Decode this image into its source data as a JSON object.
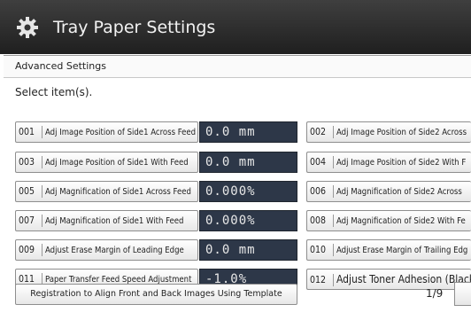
{
  "window": {
    "title": "Tray Paper Settings",
    "icon": "gear-icon"
  },
  "breadcrumb": "Advanced Settings",
  "prompt": "Select item(s).",
  "left_items": [
    {
      "num": "001",
      "label": "Adj Image Position of Side1 Across Feed",
      "value": "0.0 mm"
    },
    {
      "num": "003",
      "label": "Adj Image Position of Side1 With Feed",
      "value": "0.0 mm"
    },
    {
      "num": "005",
      "label": "Adj Magnification of Side1 Across Feed",
      "value": "0.000%"
    },
    {
      "num": "007",
      "label": "Adj Magnification of Side1 With Feed",
      "value": "0.000%"
    },
    {
      "num": "009",
      "label": "Adjust Erase Margin of Leading Edge",
      "value": "0.0 mm"
    },
    {
      "num": "011",
      "label": "Paper Transfer Feed Speed Adjustment",
      "value": "-1.0%"
    }
  ],
  "right_items": [
    {
      "num": "002",
      "label": "Adj Image Position of Side2 Across"
    },
    {
      "num": "004",
      "label": "Adj Image Position of Side2 With F"
    },
    {
      "num": "006",
      "label": "Adj Magnification of Side2 Across"
    },
    {
      "num": "008",
      "label": "Adj Magnification of Side2 With Fe"
    },
    {
      "num": "010",
      "label": "Adjust Erase Margin of Trailing Edg"
    },
    {
      "num": "012",
      "label": "Adjust Toner Adhesion (Black"
    }
  ],
  "footer": {
    "template_button": "Registration to Align Front and Back Images Using Template",
    "page": "1/9"
  }
}
